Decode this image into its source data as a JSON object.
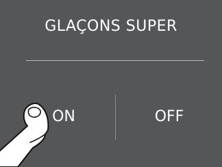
{
  "setting": {
    "title": "GLAÇONS SUPER"
  },
  "options": {
    "on_label": "ON",
    "off_label": "OFF"
  },
  "icons": {
    "pointer": "tapping-finger-icon"
  },
  "colors": {
    "panel_background": "#545658",
    "text": "#ffffff",
    "divider": "#b9bbbd"
  }
}
